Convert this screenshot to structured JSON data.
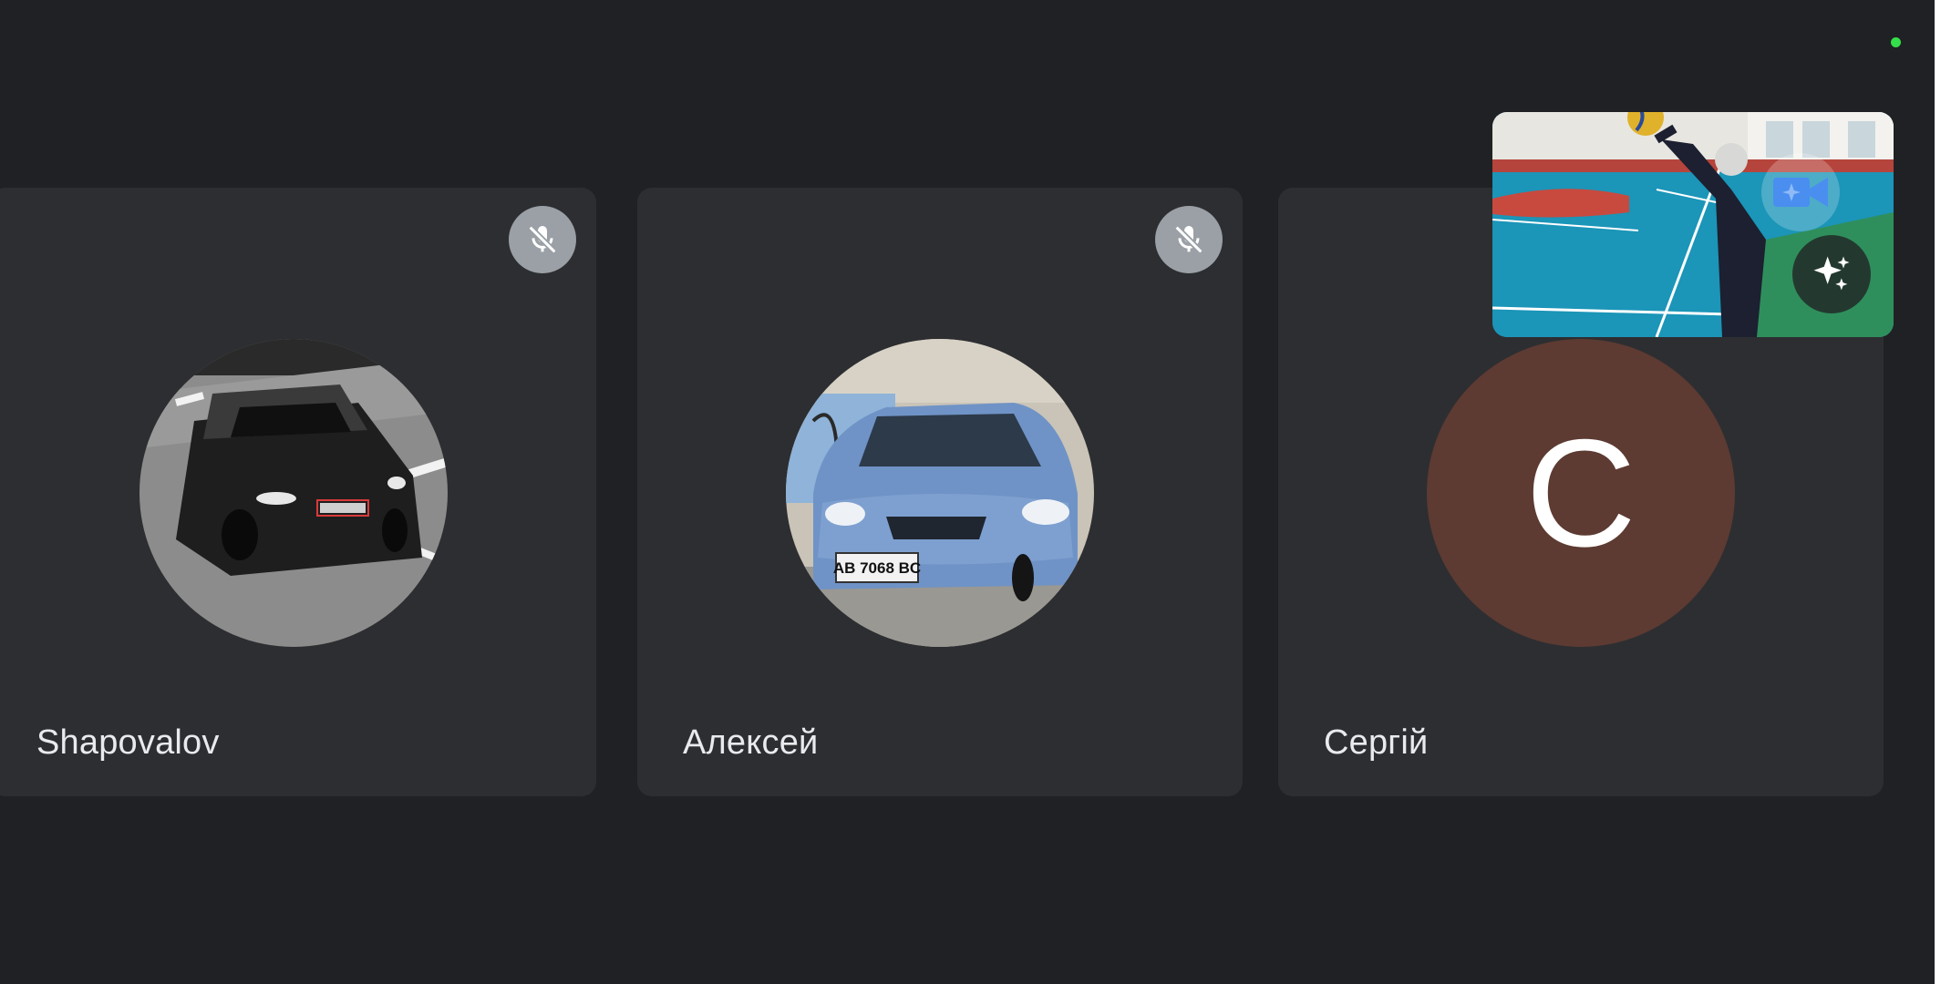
{
  "participants": [
    {
      "name": "Shapovalov",
      "muted": true,
      "avatar_type": "photo-grayscale-car"
    },
    {
      "name": "Алексей",
      "muted": true,
      "avatar_type": "photo-blue-car",
      "plate_text": "AB 7068 BC"
    },
    {
      "name": "Сергій",
      "muted": false,
      "avatar_type": "initial",
      "initial": "C",
      "avatar_color": "#5d3b32"
    }
  ],
  "self_view": {
    "controls": {
      "camera_icon": "video-effects-camera-icon",
      "effects_icon": "sparkle-effects-icon"
    }
  },
  "icons": {
    "mute": "mic-off-icon",
    "status": "recording-status-dot"
  },
  "colors": {
    "background": "#202124",
    "tile": "#2d2e31",
    "mute_badge": "#9aa0a6",
    "status_dot": "#34e04a",
    "camera_icon_accent": "#4a8ef0"
  }
}
